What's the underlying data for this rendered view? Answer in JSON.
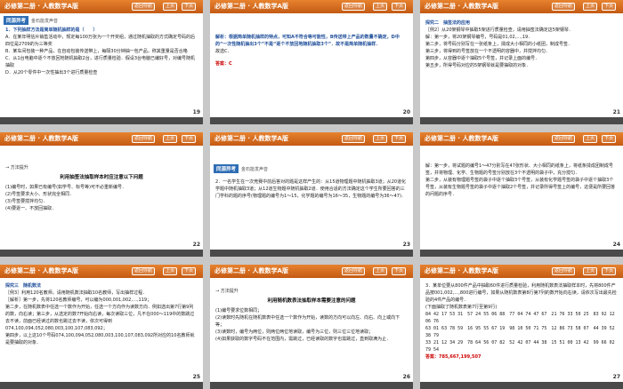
{
  "header": {
    "book": "必修第二册 · 人教数学A版",
    "nav_label": "返回导航",
    "prev_label": "上页",
    "next_label": "下页"
  },
  "tags": {
    "study": "同源异考",
    "guide": "金石能发声音"
  },
  "slides": [
    {
      "page": "19",
      "lines": [
        "1．下列抽样方法是简单随机抽样的是（　　）",
        "A．在某年明信片销售活动中，规定每100万张为一个开奖组，通过随机抽取的方式确定号码的后四位是2709的为三等奖",
        "B．某车间包装一种产品，在自动包装传送带上，每隔30分钟抽一包产品，称其重量是否合格",
        "C．从1台电脑中逐个不放回地随机抽取2台，进行质量检验．假设3台电脑已编好号，对编号随机抽取",
        "D．从20个零件中一次性抽出3个进行质量检查"
      ]
    },
    {
      "page": "20",
      "lines": [
        "解析：根据简单随机抽样的特点，可知A不符合等可能性，B传送带上产品的数量不确定，D中的“一次性随机抽出3个”不是“逐个不放回地随机抽取3个”．故不是简单随机抽样．",
        "故选C．"
      ],
      "answer": "答案：C"
    },
    {
      "page": "21",
      "lines": [
        "探究二　抽签法的应用",
        "［例2］从20架钢琴中抽取5架进行质量检查，请用抽签法确定这5架钢琴．",
        "解：第一步，将20架钢琴编号，号码是01,02,…,19．",
        "第二步，将号码分别写在一张纸条上，揉成大小相同的小纸团，制成号签．",
        "第三步，将得到的号签放在一个不透明的容器中，并搅拌均匀．",
        "第四步，从容器中逐个抽取5个号签，并记录上面的编号．",
        "第五步，所得号码对应的5架钢琴就是要抽取的对象．"
      ]
    },
    {
      "page": "22",
      "method": "方法提升",
      "title": "利用抽签法抽取样本时应注意以下问题",
      "lines": [
        "(1)编号时，如果已有编号(如学号、标号等)可不必重新编号．",
        "(2)号签要求大小、形状完全相同．",
        "(3)号签要搅拌均匀．",
        "(4)要逐一、不放回抽取．"
      ]
    },
    {
      "page": "23",
      "lines": [
        "2．一名学生在一次竞赛中前后答对的题是这样产生的：从15道物理题中随机抽取3道；从20道化学题中随机抽取3道；从12道生物题中随机抽取2道．使用合适的方法确定这个学生所要回答的三门学科的题的序号(物理题的编号为1～15，化学题的编号为16～35，生物题的编号为36～47)．"
      ]
    },
    {
      "page": "24",
      "lines": [
        "解：第一步，将试题的编号1～47分别写在47张形状、大小相同的纸条上，将纸条揉成团制成号签，并将物理、化学、生物题的号签分别放在3个不透明的袋子中，充分搅匀．",
        "第二步，从装有物理题号签的袋子中逐个抽取3个号签，从装有化学题号签的袋子中逐个抽取3个号签，从装有生物题号签的袋子中逐个抽取2个号签，并记录所得号签上的编号，这便是所要回答的问题的序号．"
      ]
    },
    {
      "page": "25",
      "lines": [
        "探究三　随机数法",
        "［例3］利用120名教师，请用随机数法抽取10名教师，写出抽样过程．",
        "［解析］第一步，先将120名教师编号，可以编为000,001,002,…,119；",
        "第二步，在随机数表中任选一个数作为开始，任选一个方向作为读数方向．例如选出第7行第9列的数，向右读；第三步，从选定的数7开始向右读，每次读取三位，凡不在000～119中的数跳过去不读，前面已经读过的数也跳过去不读，依次可得到074,100,094,052,080,003,100,107,083,092；",
        "第四步，以上这10个号码074,100,094,052,080,003,100,107,083,092所对应的10名教师就是要抽取的对象．"
      ]
    },
    {
      "page": "26",
      "method": "方法提升",
      "title": "利用随机数表法抽取样本需要注意的问题",
      "lines": [
        "(1)编号要求位数相同；",
        "(2)读数时先随机在随机数表中任选一个数作为开始，读数的方向可以向左、向右、向上或向下等；",
        "(3)读数时，编号为两位，则两位两位地读取，编号为三位，则三位三位地读取；",
        "(4)如果获取的数字号码不在范围内，需跳过，已经读取的数字也需跳过，直到取满为止．"
      ]
    },
    {
      "page": "27",
      "lines": [
        "3．某单位要从800件产品中抽取60件进行质量检验，利用随机数表法抽取样本时，先将800件产品按001,002,…,800进行编号，如果从随机数表第8行第7列的数开始向右读，请依次写出最先检验的4件产品的编号．",
        "(下面抽取了随机数表第7行至第9行)",
        "84 42 17 53 31　57 24 55 06 88　77 04 74 47 67　21 76 33 50 25　83 92 12 06 76",
        "63 01 63 78 59　16 95 55 67 19　98 10 50 71 75　12 86 73 58 07　44 39 52 38 79",
        "33 21 12 34 29　78 64 56 07 82　52 42 07 44 38　15 51 00 13 42　99 66 02 79 54"
      ],
      "answer": "答案：785,667,199,507"
    }
  ]
}
